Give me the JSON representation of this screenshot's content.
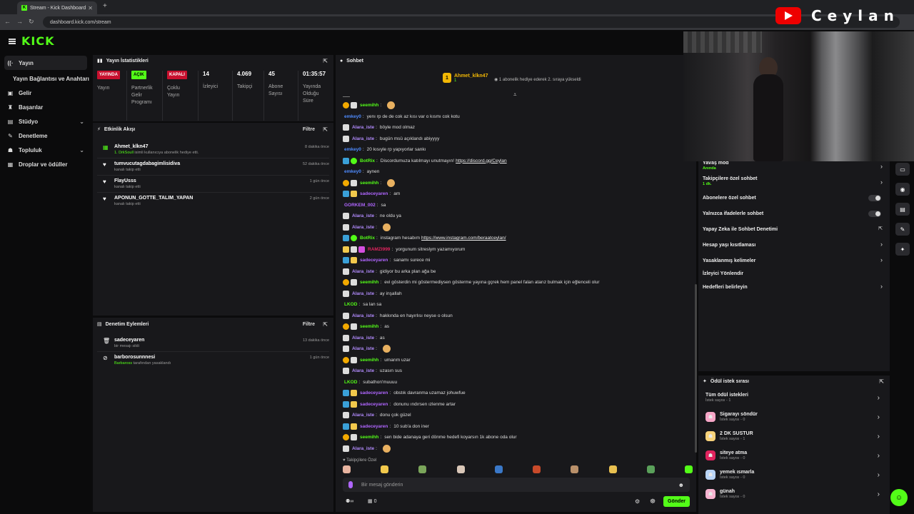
{
  "browser": {
    "tab_title": "Stream - Kick Dashboard",
    "url": "dashboard.kick.com/stream"
  },
  "brand": {
    "logo": "KICK",
    "overlay_name": "Ceylan"
  },
  "sidebar": {
    "items": [
      {
        "label": "Yayın",
        "icon": "broadcast-icon"
      },
      {
        "label": "Yayın Bağlantısı ve Anahtarı",
        "icon": ""
      },
      {
        "label": "Gelir",
        "icon": "wallet-icon"
      },
      {
        "label": "Başarılar",
        "icon": "trophy-icon"
      },
      {
        "label": "Stüdyo",
        "icon": "studio-icon"
      },
      {
        "label": "Denetleme",
        "icon": "wrench-icon"
      },
      {
        "label": "Topluluk",
        "icon": "people-icon"
      },
      {
        "label": "Droplar ve ödüller",
        "icon": "gift-icon"
      }
    ]
  },
  "stats": {
    "title": "Yayın İstatistikleri",
    "items": [
      {
        "badge": "YAYINDA",
        "label": "Yayın"
      },
      {
        "badge": "AÇIK",
        "label": "Partnerlik Gelir Programı"
      },
      {
        "badge": "KAPALI",
        "label": "Çoklu Yayın"
      },
      {
        "value": "14",
        "label": "İzleyici"
      },
      {
        "value": "4.069",
        "label": "Takipçi"
      },
      {
        "value": "45",
        "label": "Abone Sayısı"
      },
      {
        "value": "01:35:57",
        "label": "Yayında Olduğu Süre"
      }
    ]
  },
  "activity": {
    "title": "Etkinlik Akışı",
    "filter": "Filtre",
    "items": [
      {
        "name": "Ahmet_klkn47",
        "sub_green": "1. DrkSoull",
        "sub": " isimli kullanıcıya abonelik hediye etti.",
        "time": "8 dakika önce"
      },
      {
        "name": "tumvucutagdabagimlisidiva",
        "sub_green": "",
        "sub": "kanalı takip etti",
        "time": "52 dakika önce"
      },
      {
        "name": "FlayUsss",
        "sub_green": "",
        "sub": "kanalı takip etti",
        "time": "1 gün önce"
      },
      {
        "name": "APONUN_GOTTE_TALIM_YAPAN",
        "sub_green": "",
        "sub": "kanalı takip etti",
        "time": "2 gün önce"
      }
    ]
  },
  "moderation": {
    "title": "Denetim Eylemleri",
    "filter": "Filtre",
    "items": [
      {
        "name": "sadeceyaren",
        "sub_green": "",
        "sub": "bir mesajı sildi",
        "time": "13 dakika önce"
      },
      {
        "name": "barborosunnnesi",
        "sub_green": "Barbaross",
        "sub": " tarafından yasaklandı",
        "time": "1 gün önce"
      }
    ]
  },
  "chat": {
    "title": "Sohbet",
    "host": {
      "name": "Ahmet_klkn47",
      "count": "1",
      "note": "1 abonelik hediye ederek 2. sıraya yükseldi"
    },
    "messages": [
      {
        "badges": [
          "o",
          "w"
        ],
        "user": "seemihh",
        "color": "#53fc18",
        "text": "",
        "emote": true
      },
      {
        "badges": [],
        "user": "emkey0",
        "color": "#4f8cff",
        "text": "yenı rp de de cok az kısı var o kısmı cok kotu"
      },
      {
        "badges": [
          "w"
        ],
        "user": "Alara_iste",
        "color": "#b38cff",
        "text": "böyle mod olmaz"
      },
      {
        "badges": [
          "w"
        ],
        "user": "Alara_iste",
        "color": "#b38cff",
        "text": "bugün msü açıklandı abiyyyy"
      },
      {
        "badges": [],
        "user": "emkey0",
        "color": "#4f8cff",
        "text": "20 kısıyle rp yapıyorlar sankı"
      },
      {
        "badges": [
          "b",
          "g"
        ],
        "user": "BotRix",
        "color": "#53fc18",
        "text": "Discordumuza katılmayı unutmayın! ",
        "link": "https://discord.gg/Ceylan"
      },
      {
        "badges": [],
        "user": "emkey0",
        "color": "#4f8cff",
        "text": "aynen"
      },
      {
        "badges": [
          "o",
          "w"
        ],
        "user": "seemihh",
        "color": "#53fc18",
        "text": "",
        "emote": true
      },
      {
        "badges": [
          "b",
          "y"
        ],
        "user": "sadeceyaren",
        "color": "#b066ff",
        "text": "am"
      },
      {
        "badges": [],
        "user": "GORKEM_002",
        "color": "#b066ff",
        "text": "sa"
      },
      {
        "badges": [
          "w"
        ],
        "user": "Alara_iste",
        "color": "#b38cff",
        "text": "ne oldu ya"
      },
      {
        "badges": [
          "w"
        ],
        "user": "Alara_iste",
        "color": "#b38cff",
        "text": "",
        "emote": true
      },
      {
        "badges": [
          "b",
          "g"
        ],
        "user": "BotRix",
        "color": "#53fc18",
        "text": "instagram hesabım ",
        "link": "https://www.instagram.com/beraatceylan/"
      },
      {
        "badges": [
          "y",
          "w",
          "p"
        ],
        "user": "RAMZI999",
        "color": "#e0245e",
        "text": "yorgunum sitreslym yazamıyorum"
      },
      {
        "badges": [
          "b",
          "y"
        ],
        "user": "sadeceyaren",
        "color": "#b066ff",
        "text": "sanamı surece mi"
      },
      {
        "badges": [
          "w"
        ],
        "user": "Alara_iste",
        "color": "#b38cff",
        "text": "gidiyor bu arka plan ağa be"
      },
      {
        "badges": [
          "o",
          "w"
        ],
        "user": "seemihh",
        "color": "#53fc18",
        "text": "evi gösterdin mi göstermediysen gösterme yayına gçrek hem panel falan atarız bulmak için eğlenceli olur"
      },
      {
        "badges": [
          "w"
        ],
        "user": "Alara_iste",
        "color": "#b38cff",
        "text": "ay inşallah"
      },
      {
        "badges": [],
        "user": "LKOD",
        "color": "#53fc18",
        "text": "sa lan sa"
      },
      {
        "badges": [
          "w"
        ],
        "user": "Alara_iste",
        "color": "#b38cff",
        "text": "hakkında en hayırlısı neyse o olsun"
      },
      {
        "badges": [
          "o",
          "w"
        ],
        "user": "seemihh",
        "color": "#53fc18",
        "text": "as"
      },
      {
        "badges": [
          "w"
        ],
        "user": "Alara_iste",
        "color": "#b38cff",
        "text": "as"
      },
      {
        "badges": [
          "w"
        ],
        "user": "Alara_iste",
        "color": "#b38cff",
        "text": "",
        "emote": true
      },
      {
        "badges": [
          "o",
          "w"
        ],
        "user": "seemihh",
        "color": "#53fc18",
        "text": "umarım uzar"
      },
      {
        "badges": [
          "w"
        ],
        "user": "Alara_iste",
        "color": "#b38cff",
        "text": "uzasın sus"
      },
      {
        "badges": [],
        "user": "LKOD",
        "color": "#53fc18",
        "text": "subathon'muuuu"
      },
      {
        "badges": [
          "b",
          "y"
        ],
        "user": "sadeceyaren",
        "color": "#b066ff",
        "text": "obstık davranma uzamaz johuwfue"
      },
      {
        "badges": [
          "b",
          "y"
        ],
        "user": "sadeceyaren",
        "color": "#b066ff",
        "text": "donunu ındırsen ızlenme artar"
      },
      {
        "badges": [
          "w"
        ],
        "user": "Alara_iste",
        "color": "#b38cff",
        "text": "donu çok güzel"
      },
      {
        "badges": [
          "b",
          "y"
        ],
        "user": "sadeceyaren",
        "color": "#b066ff",
        "text": "10 sub'a don iner"
      },
      {
        "badges": [
          "o",
          "w"
        ],
        "user": "seemihh",
        "color": "#53fc18",
        "text": "sen bide adanaya geri dönme hedefi koyarsın 1k abone oda olur"
      },
      {
        "badges": [
          "w"
        ],
        "user": "Alara_iste",
        "color": "#b38cff",
        "text": "",
        "emote": true
      }
    ],
    "followers_only": "Takipçilere Özel",
    "input_placeholder": "Bir mesaj gönderin",
    "send": "Gönder",
    "infinity": "∞",
    "gift_count": "0"
  },
  "settings": [
    {
      "label": "Yavaş mod",
      "sub": "Anında",
      "control": "chevron"
    },
    {
      "label": "Takipçilere özel sohbet",
      "sub": "1 dk.",
      "control": "chevron"
    },
    {
      "label": "Abonelere özel sohbet",
      "sub": "",
      "control": "toggle"
    },
    {
      "label": "Yalnızca ifadelerle sohbet",
      "sub": "",
      "control": "toggle"
    },
    {
      "label": "Yapay Zeka ile Sohbet Denetimi",
      "sub": "",
      "control": "popout"
    },
    {
      "label": "Hesap yaşı kısıtlaması",
      "sub": "",
      "control": "chevron"
    },
    {
      "label": "Yasaklanmış kelimeler",
      "sub": "",
      "control": "chevron"
    },
    {
      "label": "İzleyici Yönlendir",
      "sub": "",
      "control": ""
    },
    {
      "label": "Hedefleri belirleyin",
      "sub": "",
      "control": "chevron"
    }
  ],
  "rewards": {
    "title": "Ödül istek sırası",
    "items": [
      {
        "name": "Tüm ödül istekleri",
        "sub": "İstek sayısı - 1",
        "color": ""
      },
      {
        "name": "Sigarayı söndür",
        "sub": "İstek sayısı - 0",
        "color": "#f7a6c7"
      },
      {
        "name": "2 DK SUSTUR",
        "sub": "İstek sayısı - 1",
        "color": "#f7d27a"
      },
      {
        "name": "siteye atma",
        "sub": "İstek sayısı - 0",
        "color": "#e0245e"
      },
      {
        "name": "yemek ısmarla",
        "sub": "İstek sayısı - 0",
        "color": "#b9d4f7"
      },
      {
        "name": "günah",
        "sub": "İstek sayısı - 0",
        "color": "#f7b3d0"
      }
    ]
  }
}
